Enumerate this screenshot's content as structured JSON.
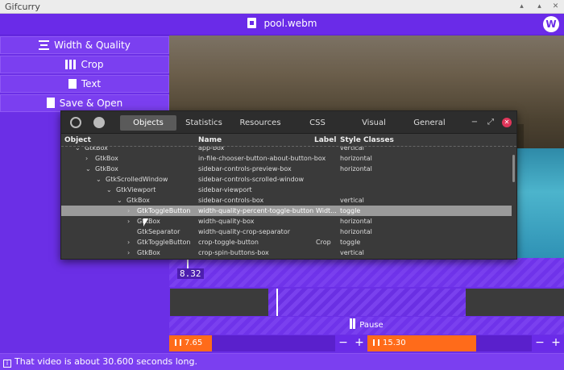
{
  "os": {
    "title": "Gifcurry"
  },
  "header": {
    "filename": "pool.webm",
    "logo": "logo-icon"
  },
  "sidebar": {
    "items": [
      {
        "label": "Width & Quality",
        "icon": "width-quality-icon"
      },
      {
        "label": "Crop",
        "icon": "crop-icon"
      },
      {
        "label": "Text",
        "icon": "text-icon"
      },
      {
        "label": "Save & Open",
        "icon": "save-icon"
      }
    ]
  },
  "inspector": {
    "tabs": [
      "Objects",
      "Statistics",
      "Resources",
      "CSS",
      "Visual",
      "General"
    ],
    "active_tab": "Objects",
    "columns": [
      "Object",
      "Name",
      "Label",
      "Style Classes"
    ],
    "rows": [
      {
        "object": "GtkBox",
        "name": "app-box",
        "label": "",
        "style": "vertical",
        "indent": 1,
        "expander": "expanded"
      },
      {
        "object": "GtkBox",
        "name": "in-file-chooser-button-about-button-box",
        "label": "",
        "style": "horizontal",
        "indent": 2,
        "expander": "collapsed"
      },
      {
        "object": "GtkBox",
        "name": "sidebar-controls-preview-box",
        "label": "",
        "style": "horizontal",
        "indent": 2,
        "expander": "expanded"
      },
      {
        "object": "GtkScrolledWindow",
        "name": "sidebar-controls-scrolled-window",
        "label": "",
        "style": "",
        "indent": 3,
        "expander": "expanded"
      },
      {
        "object": "GtkViewport",
        "name": "sidebar-viewport",
        "label": "",
        "style": "",
        "indent": 4,
        "expander": "expanded"
      },
      {
        "object": "GtkBox",
        "name": "sidebar-controls-box",
        "label": "",
        "style": "vertical",
        "indent": 5,
        "expander": "expanded"
      },
      {
        "object": "GtkToggleButton",
        "name": "width-quality-percent-toggle-button",
        "label": "Widt...",
        "style": "toggle",
        "indent": 6,
        "expander": "collapsed",
        "selected": true
      },
      {
        "object": "GtkBox",
        "name": "width-quality-box",
        "label": "",
        "style": "horizontal",
        "indent": 6,
        "expander": "collapsed"
      },
      {
        "object": "GtkSeparator",
        "name": "width-quality-crop-separator",
        "label": "",
        "style": "horizontal",
        "indent": 6,
        "expander": "none"
      },
      {
        "object": "GtkToggleButton",
        "name": "crop-toggle-button",
        "label": "Crop",
        "style": "toggle",
        "indent": 6,
        "expander": "collapsed"
      },
      {
        "object": "GtkBox",
        "name": "crop-spin-buttons-box",
        "label": "",
        "style": "vertical",
        "indent": 6,
        "expander": "collapsed"
      }
    ]
  },
  "timeline": {
    "timecode": "8.32",
    "start_value": "7.65",
    "end_value": "15.30"
  },
  "playback": {
    "pause_label": "Pause"
  },
  "status": {
    "message": "That video is about 30.600 seconds long."
  }
}
